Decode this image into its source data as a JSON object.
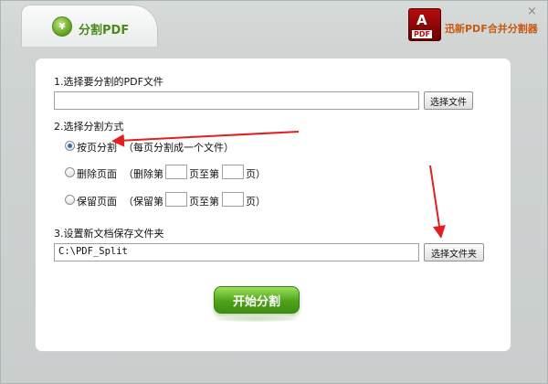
{
  "window": {
    "title": "分割PDF",
    "title_logo": "¥",
    "brand_name": "迅新PDF合并分割器",
    "brand_glyph": "A",
    "brand_pdf": "PDF",
    "close": "×"
  },
  "section1": {
    "label": "1.选择要分割的PDF文件",
    "file_value": "",
    "button": "选择文件"
  },
  "section2": {
    "label": "2.选择分割方式",
    "option1": {
      "name": "按页分割",
      "desc": "（每页分割成一个文件）",
      "checked": true
    },
    "option2": {
      "name": "删除页面",
      "from_label": "（删除第",
      "to_label": "页至第",
      "end_label": "页）"
    },
    "option3": {
      "name": "保留页面",
      "from_label": "（保留第",
      "to_label": "页至第",
      "end_label": "页）"
    }
  },
  "section3": {
    "label": "3.设置新文档保存文件夹",
    "folder_value": "C:\\PDF_Split",
    "button": "选择文件夹"
  },
  "start_button": "开始分割",
  "colors": {
    "accent_green": "#4fa31b",
    "annotation_red": "#e02020",
    "brand_orange": "#c75a12"
  }
}
